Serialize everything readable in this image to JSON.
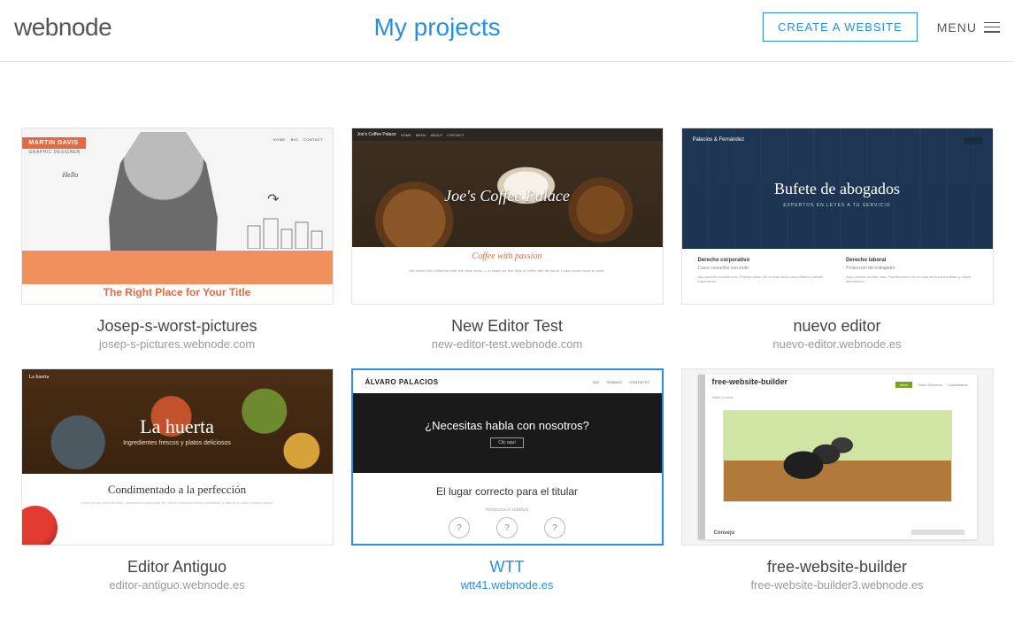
{
  "header": {
    "logo": "webnode",
    "title": "My projects",
    "create_btn": "CREATE A WEBSITE",
    "menu_label": "MENU"
  },
  "projects": [
    {
      "name": "Josep-s-worst-pictures",
      "url": "josep-s-pictures.webnode.com",
      "selected": false,
      "thumb": {
        "badge": "MARTIN DAVIS",
        "subtitle": "GRAPHIC DESIGNER",
        "nav": [
          "HOME",
          "BIO",
          "CONTACT"
        ],
        "hello": "Hello",
        "caption": "The Right Place for Your Title"
      }
    },
    {
      "name": "New Editor Test",
      "url": "new-editor-test.webnode.com",
      "selected": false,
      "thumb": {
        "brand": "Joe's Coffee Palace",
        "nav": [
          "HOME",
          "MENU",
          "ABOUT",
          "CONTACT"
        ],
        "hero": "Joe's Coffee Palace",
        "tagline": "Coffee with passion",
        "body": "We started this coffee bar with one clear vision — to share our true style of coffee with the world. Lorem ipsum dolor sit amet."
      }
    },
    {
      "name": "nuevo editor",
      "url": "nuevo-editor.webnode.es",
      "selected": false,
      "thumb": {
        "brand": "Palacios & Fernández",
        "hero": "Bufete de abogados",
        "sub": "EXPERTOS EN LEYES A TU SERVICIO",
        "col1_h": "Derecho corporativo",
        "col1_i": "Casos resueltos con éxito",
        "col2_h": "Derecho laboral",
        "col2_i": "Protección del trabajador",
        "lorem": "Aquí puedes escribir más. Puedes hacer clic en este texto para editarlo y añadir información."
      }
    },
    {
      "name": "Editor Antiguo",
      "url": "editor-antiguo.webnode.es",
      "selected": false,
      "thumb": {
        "brand": "La huerta",
        "hero": "La huerta",
        "sub": "Ingredientes frescos y platos deliciosos",
        "caption": "Condimentado a la perfección",
        "lorem": "Lorem ipsum dolor sit amet, consectetur adipiscing elit, sed do eiusmod tempor incididunt ut labore et dolore magna aliqua."
      }
    },
    {
      "name": "WTT",
      "url": "wtt41.webnode.es",
      "selected": true,
      "thumb": {
        "brand": "ÁLVARO PALACIOS",
        "nav": [
          "BIO",
          "TRABAJO",
          "CONTACTO"
        ],
        "hero": "¿Necesitas habla con nosotros?",
        "btn": "Clic aquí",
        "caption": "El lugar correcto para el titular",
        "sub": "Introduzca el subtítulo",
        "q": "?"
      }
    },
    {
      "name": "free-website-builder",
      "url": "free-website-builder3.webnode.es",
      "selected": false,
      "thumb": {
        "title": "free-website-builder",
        "sub": "Make it shine",
        "nav_pill": "Inicio",
        "nav": [
          "Sobre Nosotros",
          "Contáctanos"
        ],
        "tip": "Consejo"
      }
    }
  ]
}
